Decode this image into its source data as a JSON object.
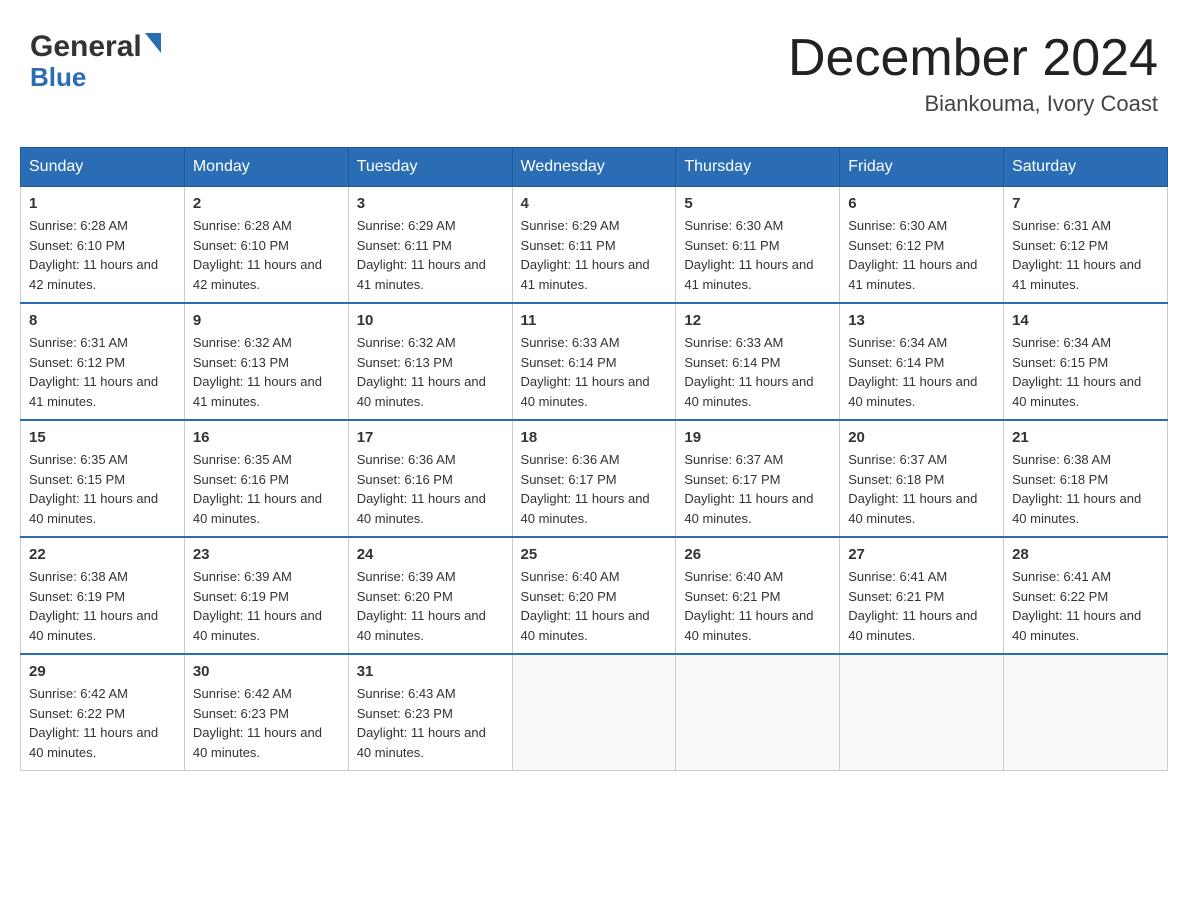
{
  "header": {
    "logo_general": "General",
    "logo_blue": "Blue",
    "month_title": "December 2024",
    "location": "Biankouma, Ivory Coast"
  },
  "days_of_week": [
    "Sunday",
    "Monday",
    "Tuesday",
    "Wednesday",
    "Thursday",
    "Friday",
    "Saturday"
  ],
  "weeks": [
    [
      {
        "day": "1",
        "sunrise": "Sunrise: 6:28 AM",
        "sunset": "Sunset: 6:10 PM",
        "daylight": "Daylight: 11 hours and 42 minutes."
      },
      {
        "day": "2",
        "sunrise": "Sunrise: 6:28 AM",
        "sunset": "Sunset: 6:10 PM",
        "daylight": "Daylight: 11 hours and 42 minutes."
      },
      {
        "day": "3",
        "sunrise": "Sunrise: 6:29 AM",
        "sunset": "Sunset: 6:11 PM",
        "daylight": "Daylight: 11 hours and 41 minutes."
      },
      {
        "day": "4",
        "sunrise": "Sunrise: 6:29 AM",
        "sunset": "Sunset: 6:11 PM",
        "daylight": "Daylight: 11 hours and 41 minutes."
      },
      {
        "day": "5",
        "sunrise": "Sunrise: 6:30 AM",
        "sunset": "Sunset: 6:11 PM",
        "daylight": "Daylight: 11 hours and 41 minutes."
      },
      {
        "day": "6",
        "sunrise": "Sunrise: 6:30 AM",
        "sunset": "Sunset: 6:12 PM",
        "daylight": "Daylight: 11 hours and 41 minutes."
      },
      {
        "day": "7",
        "sunrise": "Sunrise: 6:31 AM",
        "sunset": "Sunset: 6:12 PM",
        "daylight": "Daylight: 11 hours and 41 minutes."
      }
    ],
    [
      {
        "day": "8",
        "sunrise": "Sunrise: 6:31 AM",
        "sunset": "Sunset: 6:12 PM",
        "daylight": "Daylight: 11 hours and 41 minutes."
      },
      {
        "day": "9",
        "sunrise": "Sunrise: 6:32 AM",
        "sunset": "Sunset: 6:13 PM",
        "daylight": "Daylight: 11 hours and 41 minutes."
      },
      {
        "day": "10",
        "sunrise": "Sunrise: 6:32 AM",
        "sunset": "Sunset: 6:13 PM",
        "daylight": "Daylight: 11 hours and 40 minutes."
      },
      {
        "day": "11",
        "sunrise": "Sunrise: 6:33 AM",
        "sunset": "Sunset: 6:14 PM",
        "daylight": "Daylight: 11 hours and 40 minutes."
      },
      {
        "day": "12",
        "sunrise": "Sunrise: 6:33 AM",
        "sunset": "Sunset: 6:14 PM",
        "daylight": "Daylight: 11 hours and 40 minutes."
      },
      {
        "day": "13",
        "sunrise": "Sunrise: 6:34 AM",
        "sunset": "Sunset: 6:14 PM",
        "daylight": "Daylight: 11 hours and 40 minutes."
      },
      {
        "day": "14",
        "sunrise": "Sunrise: 6:34 AM",
        "sunset": "Sunset: 6:15 PM",
        "daylight": "Daylight: 11 hours and 40 minutes."
      }
    ],
    [
      {
        "day": "15",
        "sunrise": "Sunrise: 6:35 AM",
        "sunset": "Sunset: 6:15 PM",
        "daylight": "Daylight: 11 hours and 40 minutes."
      },
      {
        "day": "16",
        "sunrise": "Sunrise: 6:35 AM",
        "sunset": "Sunset: 6:16 PM",
        "daylight": "Daylight: 11 hours and 40 minutes."
      },
      {
        "day": "17",
        "sunrise": "Sunrise: 6:36 AM",
        "sunset": "Sunset: 6:16 PM",
        "daylight": "Daylight: 11 hours and 40 minutes."
      },
      {
        "day": "18",
        "sunrise": "Sunrise: 6:36 AM",
        "sunset": "Sunset: 6:17 PM",
        "daylight": "Daylight: 11 hours and 40 minutes."
      },
      {
        "day": "19",
        "sunrise": "Sunrise: 6:37 AM",
        "sunset": "Sunset: 6:17 PM",
        "daylight": "Daylight: 11 hours and 40 minutes."
      },
      {
        "day": "20",
        "sunrise": "Sunrise: 6:37 AM",
        "sunset": "Sunset: 6:18 PM",
        "daylight": "Daylight: 11 hours and 40 minutes."
      },
      {
        "day": "21",
        "sunrise": "Sunrise: 6:38 AM",
        "sunset": "Sunset: 6:18 PM",
        "daylight": "Daylight: 11 hours and 40 minutes."
      }
    ],
    [
      {
        "day": "22",
        "sunrise": "Sunrise: 6:38 AM",
        "sunset": "Sunset: 6:19 PM",
        "daylight": "Daylight: 11 hours and 40 minutes."
      },
      {
        "day": "23",
        "sunrise": "Sunrise: 6:39 AM",
        "sunset": "Sunset: 6:19 PM",
        "daylight": "Daylight: 11 hours and 40 minutes."
      },
      {
        "day": "24",
        "sunrise": "Sunrise: 6:39 AM",
        "sunset": "Sunset: 6:20 PM",
        "daylight": "Daylight: 11 hours and 40 minutes."
      },
      {
        "day": "25",
        "sunrise": "Sunrise: 6:40 AM",
        "sunset": "Sunset: 6:20 PM",
        "daylight": "Daylight: 11 hours and 40 minutes."
      },
      {
        "day": "26",
        "sunrise": "Sunrise: 6:40 AM",
        "sunset": "Sunset: 6:21 PM",
        "daylight": "Daylight: 11 hours and 40 minutes."
      },
      {
        "day": "27",
        "sunrise": "Sunrise: 6:41 AM",
        "sunset": "Sunset: 6:21 PM",
        "daylight": "Daylight: 11 hours and 40 minutes."
      },
      {
        "day": "28",
        "sunrise": "Sunrise: 6:41 AM",
        "sunset": "Sunset: 6:22 PM",
        "daylight": "Daylight: 11 hours and 40 minutes."
      }
    ],
    [
      {
        "day": "29",
        "sunrise": "Sunrise: 6:42 AM",
        "sunset": "Sunset: 6:22 PM",
        "daylight": "Daylight: 11 hours and 40 minutes."
      },
      {
        "day": "30",
        "sunrise": "Sunrise: 6:42 AM",
        "sunset": "Sunset: 6:23 PM",
        "daylight": "Daylight: 11 hours and 40 minutes."
      },
      {
        "day": "31",
        "sunrise": "Sunrise: 6:43 AM",
        "sunset": "Sunset: 6:23 PM",
        "daylight": "Daylight: 11 hours and 40 minutes."
      },
      null,
      null,
      null,
      null
    ]
  ]
}
